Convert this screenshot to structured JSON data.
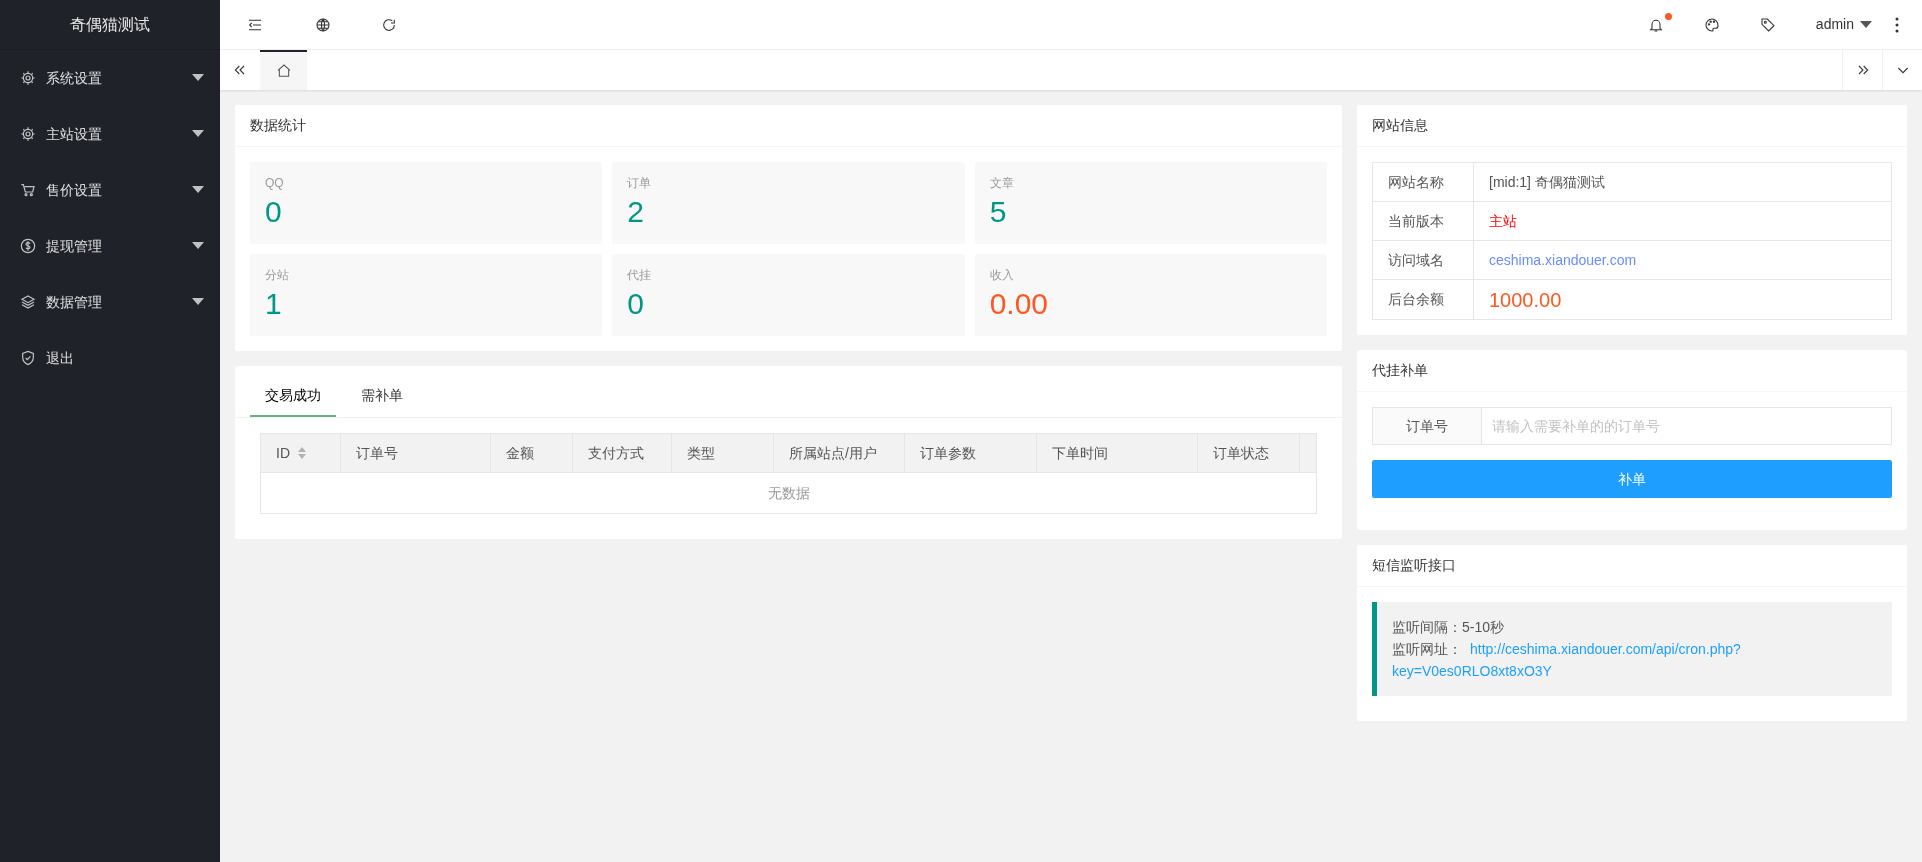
{
  "sidebar": {
    "title": "奇偶猫测试",
    "items": [
      {
        "label": "系统设置",
        "kind": "gear",
        "has_submenu": true
      },
      {
        "label": "主站设置",
        "kind": "gear",
        "has_submenu": true
      },
      {
        "label": "售价设置",
        "kind": "cart",
        "has_submenu": true
      },
      {
        "label": "提现管理",
        "kind": "dollar",
        "has_submenu": true
      },
      {
        "label": "数据管理",
        "kind": "layers",
        "has_submenu": true
      },
      {
        "label": "退出",
        "kind": "shield",
        "has_submenu": false
      }
    ]
  },
  "topbar": {
    "notification_dot": true,
    "user": "admin"
  },
  "stats": {
    "title": "数据统计",
    "items": [
      {
        "label": "QQ",
        "value": "0",
        "color": "#009688"
      },
      {
        "label": "订单",
        "value": "2",
        "color": "#009688"
      },
      {
        "label": "文章",
        "value": "5",
        "color": "#009688"
      },
      {
        "label": "分站",
        "value": "1",
        "color": "#009688"
      },
      {
        "label": "代挂",
        "value": "0",
        "color": "#009688"
      },
      {
        "label": "收入",
        "value": "0.00",
        "color": "#ff5722"
      }
    ]
  },
  "orders": {
    "tabs": [
      {
        "label": "交易成功",
        "selected": true
      },
      {
        "label": "需补单",
        "selected": false
      }
    ],
    "table": {
      "columns": [
        "ID",
        "订单号",
        "金额",
        "支付方式",
        "类型",
        "所属站点/用户",
        "订单参数",
        "下单时间",
        "订单状态"
      ],
      "empty_text": "无数据"
    }
  },
  "site_info": {
    "title": "网站信息",
    "rows": [
      {
        "label": "网站名称",
        "value": "[mid:1] 奇偶猫测试",
        "kind": "plain"
      },
      {
        "label": "当前版本",
        "value": "主站",
        "kind": "alert"
      },
      {
        "label": "访问域名",
        "value": "ceshima.xiandouer.com",
        "kind": "link"
      },
      {
        "label": "后台余额",
        "value": "1000.00",
        "kind": "amount"
      }
    ]
  },
  "resupply": {
    "title": "代挂补单",
    "field_label": "订单号",
    "placeholder": "请输入需要补单的的订单号",
    "button": "补单"
  },
  "sms": {
    "title": "短信监听接口",
    "interval_label": "监听间隔：",
    "interval": "5-10秒",
    "url_label": "监听网址：",
    "url_lines": [
      "http://ceshima.xiandouer.com/api/cron.php?",
      "key=V0es0RLO8xt8xO3Y"
    ]
  }
}
